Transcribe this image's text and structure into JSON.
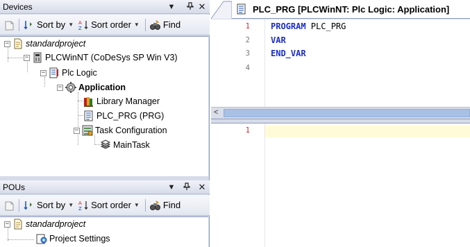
{
  "devices_panel": {
    "title": "Devices",
    "dropdown_icon": "▾",
    "pin_icon": "ꟷ",
    "close_icon": "✕",
    "toolbar": {
      "sort_by_label": "Sort by",
      "sort_order_label": "Sort order",
      "find_label": "Find"
    },
    "tree": {
      "project": "standardproject",
      "device": "PLCWinNT (CoDeSys SP Win V3)",
      "plc_logic": "Plc Logic",
      "application": "Application",
      "library_manager": "Library Manager",
      "plc_prg": "PLC_PRG (PRG)",
      "task_configuration": "Task Configuration",
      "main_task": "MainTask"
    }
  },
  "pous_panel": {
    "title": "POUs",
    "toolbar": {
      "sort_by_label": "Sort by",
      "sort_order_label": "Sort order",
      "find_label": "Find"
    },
    "tree": {
      "project": "standardproject",
      "project_settings": "Project Settings"
    }
  },
  "editor": {
    "tab_title": "PLC_PRG [PLCWinNT: Plc Logic: Application]",
    "declaration": {
      "line_numbers": [
        "1",
        "2",
        "3",
        "4"
      ],
      "lines": [
        {
          "kw": "PROGRAM",
          "rest": " PLC_PRG"
        },
        {
          "kw": "VAR",
          "rest": ""
        },
        {
          "kw": "END_VAR",
          "rest": ""
        },
        {
          "kw": "",
          "rest": ""
        }
      ]
    },
    "implementation": {
      "line_numbers": [
        "1"
      ]
    },
    "scroll_left_icon": "<"
  },
  "colors": {
    "keyword": "#1c2ec8",
    "line_number_red": "#c8302c",
    "panel_bg": "#d6dbe9",
    "highlight_line": "#fffbd9"
  }
}
